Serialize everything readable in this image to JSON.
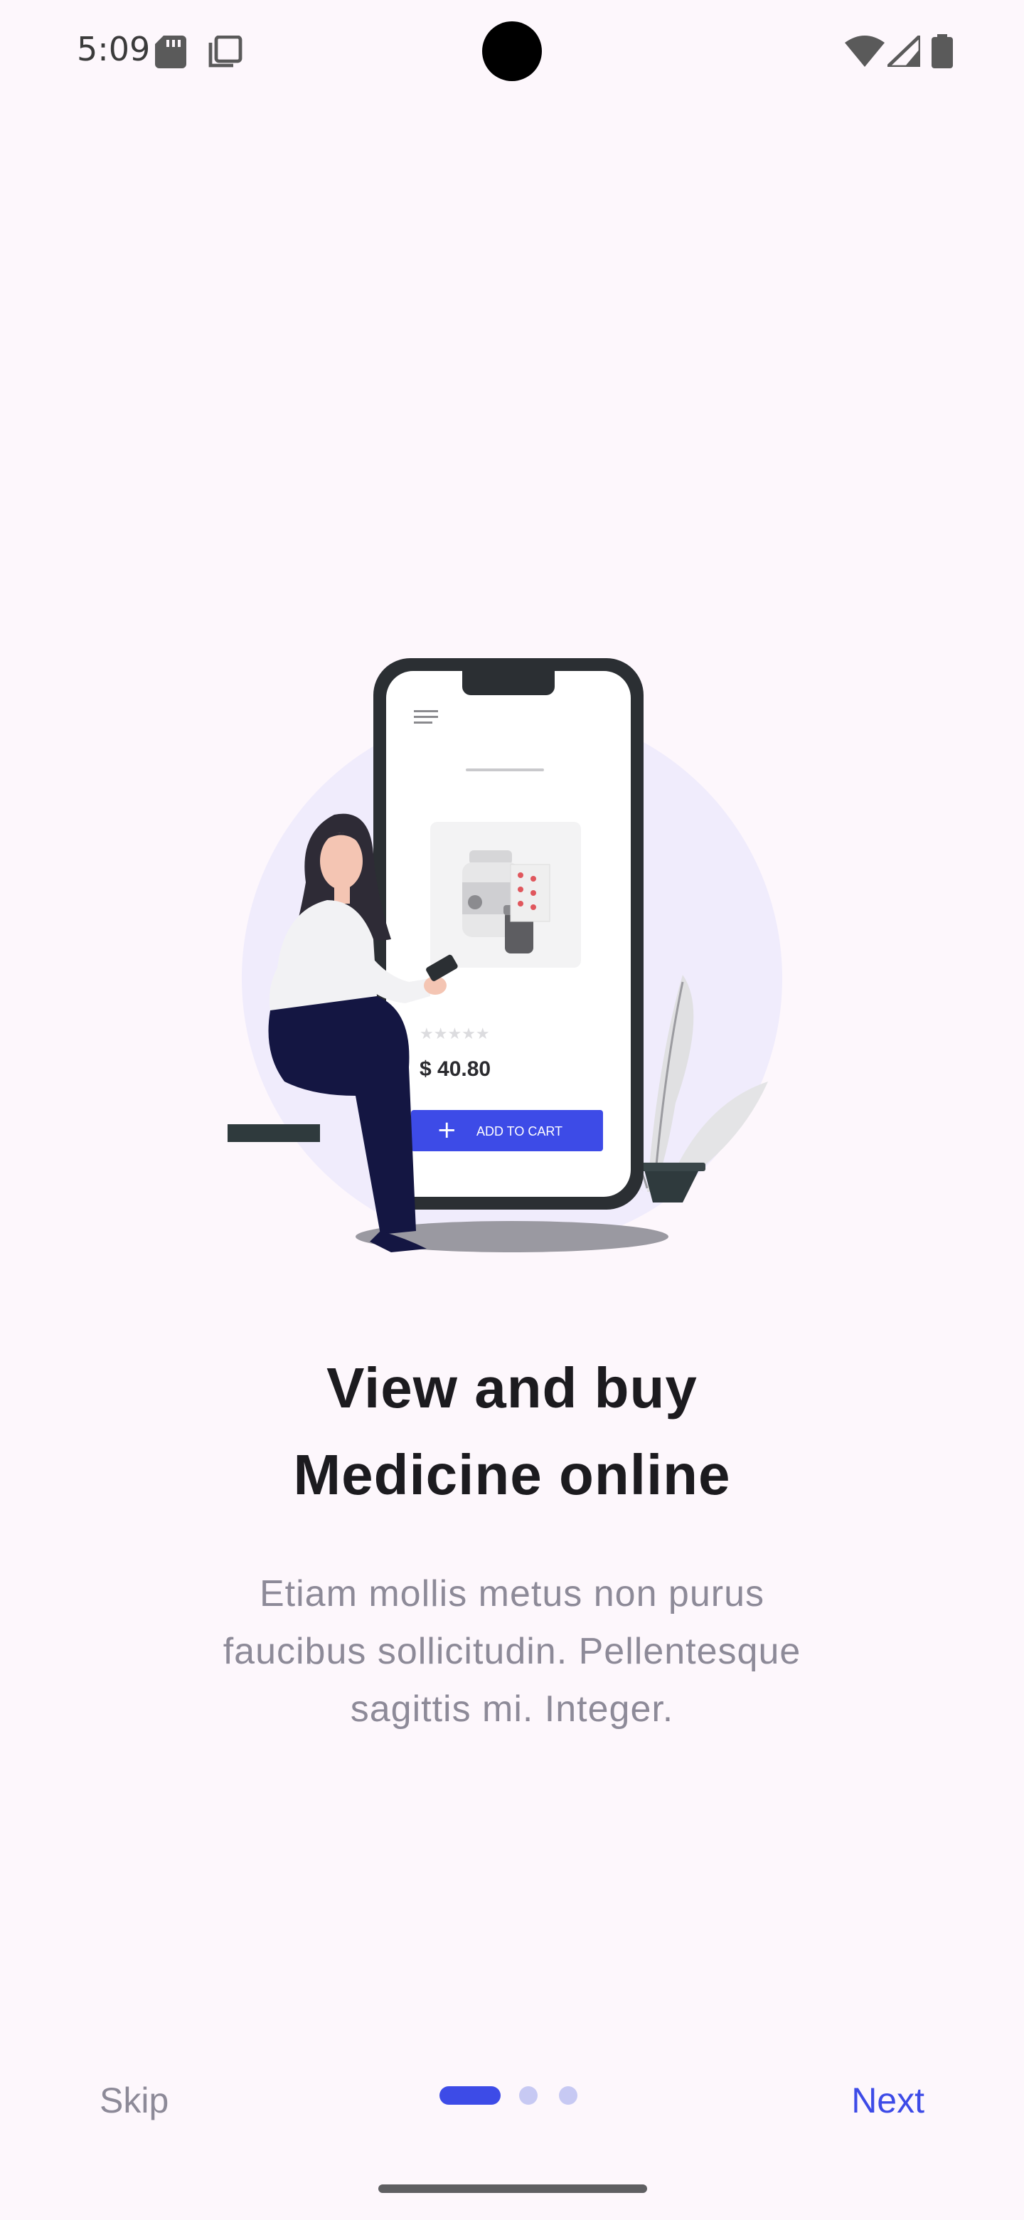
{
  "status_bar": {
    "time": "5:09",
    "icons": [
      "sd-card-icon",
      "copy-icon",
      "wifi-icon",
      "signal-icon",
      "battery-icon"
    ]
  },
  "illustration": {
    "price": "$ 40.80",
    "cart_button_label": "ADD TO CART"
  },
  "content": {
    "title_line1": "View and buy",
    "title_line2": "Medicine online",
    "description_line1": "Etiam mollis metus non purus",
    "description_line2": "faucibus sollicitudin. Pellentesque",
    "description_line3": "sagittis mi. Integer."
  },
  "navigation": {
    "skip_label": "Skip",
    "next_label": "Next",
    "current_page": 1,
    "total_pages": 3
  },
  "colors": {
    "background": "#fdf7fc",
    "accent": "#3d4be7",
    "title": "#1c1b1f",
    "muted_text": "#8d8a98",
    "inactive_dot": "#c7c9f3"
  }
}
